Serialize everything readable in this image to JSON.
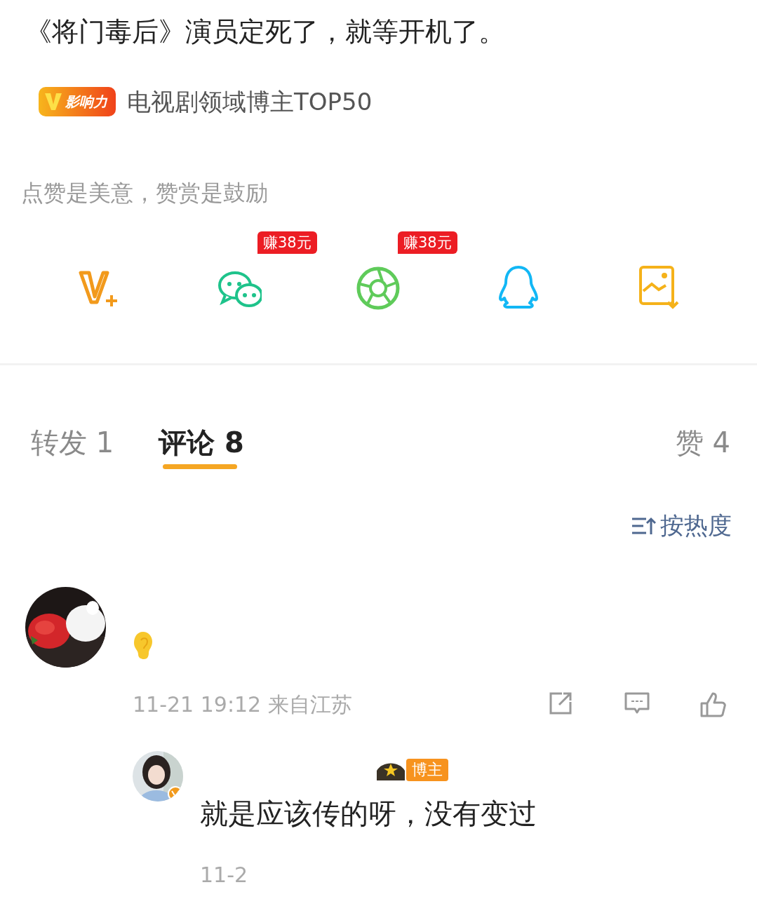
{
  "post": {
    "title": "《将门毒后》演员定死了，就等开机了。",
    "influence_badge": "影响力",
    "influence_label": "电视剧领域博主TOP50"
  },
  "reward": {
    "prompt": "点赞是美意，赞赏是鼓励"
  },
  "share_targets": [
    {
      "kind": "vplus"
    },
    {
      "kind": "wechat",
      "tag": "赚38元"
    },
    {
      "kind": "moments",
      "tag": "赚38元"
    },
    {
      "kind": "qq"
    },
    {
      "kind": "save"
    }
  ],
  "tabs": [
    {
      "label": "转发",
      "count": "1",
      "selected": false
    },
    {
      "label": "评论",
      "count": "8",
      "selected": true
    },
    {
      "label": "赞",
      "count": "4",
      "selected": false
    }
  ],
  "sort": {
    "label": "按热度"
  },
  "comments": [
    {
      "time": "11-21 19:12 来自江苏",
      "replies": [
        {
          "author_tag": "博主",
          "text": "就是应该传的呀，没有变过",
          "time": "11-2"
        }
      ]
    }
  ]
}
